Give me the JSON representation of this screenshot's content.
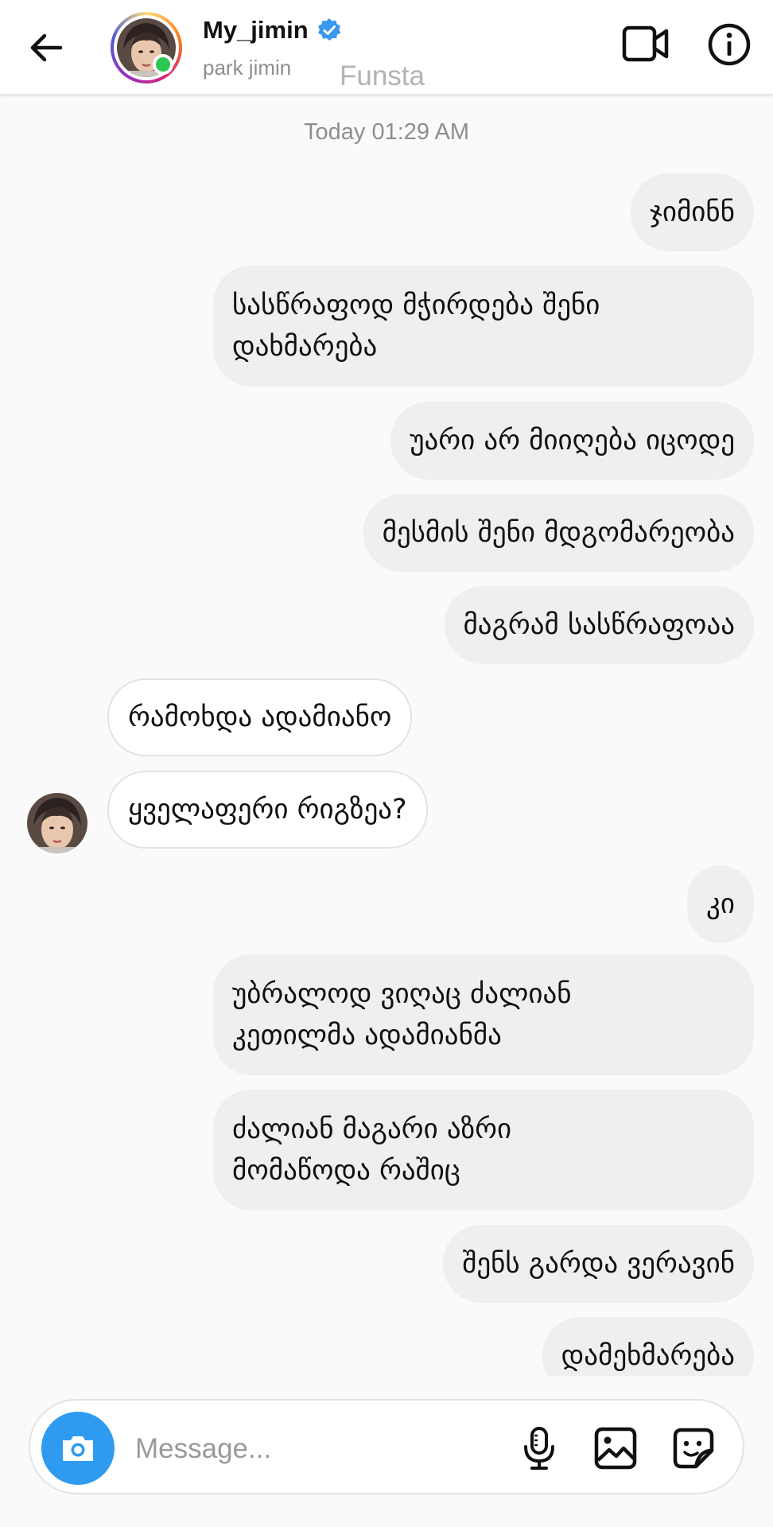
{
  "header": {
    "username": "My_jimin",
    "subtitle": "park jimin",
    "overlay_text": "Funsta",
    "verified": true,
    "online": true
  },
  "chat": {
    "timestamp": "Today 01:29 AM",
    "messages": [
      {
        "from": "me",
        "text": "ჯიმინნ"
      },
      {
        "from": "me",
        "text": "სასწრაფოდ მჭირდება შენი\nდახმარება"
      },
      {
        "from": "me",
        "text": "უარი არ მიიღება იცოდე"
      },
      {
        "from": "me",
        "text": "მესმის შენი მდგომარეობა"
      },
      {
        "from": "me",
        "text": "მაგრამ სასწრაფოაა"
      },
      {
        "from": "them",
        "text": "რამოხდა ადამიანო"
      },
      {
        "from": "them",
        "text": "ყველაფერი რიგზეა?"
      },
      {
        "from": "me",
        "text": "კი"
      },
      {
        "from": "me",
        "text": "უბრალოდ ვიღაც ძალიან\nკეთილმა ადამიანმა"
      },
      {
        "from": "me",
        "text": "ძალიან მაგარი აზრი\nმომაწოდა რაშიც"
      },
      {
        "from": "me",
        "text": "შენს გარდა ვერავინ"
      },
      {
        "from": "me",
        "text": "დამეხმარება"
      }
    ]
  },
  "composer": {
    "placeholder": "Message...",
    "value": ""
  },
  "icons": {
    "back": "arrow-left-icon",
    "video": "video-camera-icon",
    "info": "info-icon",
    "camera": "camera-icon",
    "mic": "microphone-icon",
    "gallery": "image-icon",
    "sticker": "sticker-icon",
    "verified": "verified-badge-icon"
  },
  "colors": {
    "accent_blue": "#2e9bf0",
    "verified_blue": "#3897f0",
    "online_green": "#2dc653",
    "sent_bubble": "#efefef",
    "received_bubble": "#ffffff",
    "muted_text": "#8e8e8e"
  }
}
